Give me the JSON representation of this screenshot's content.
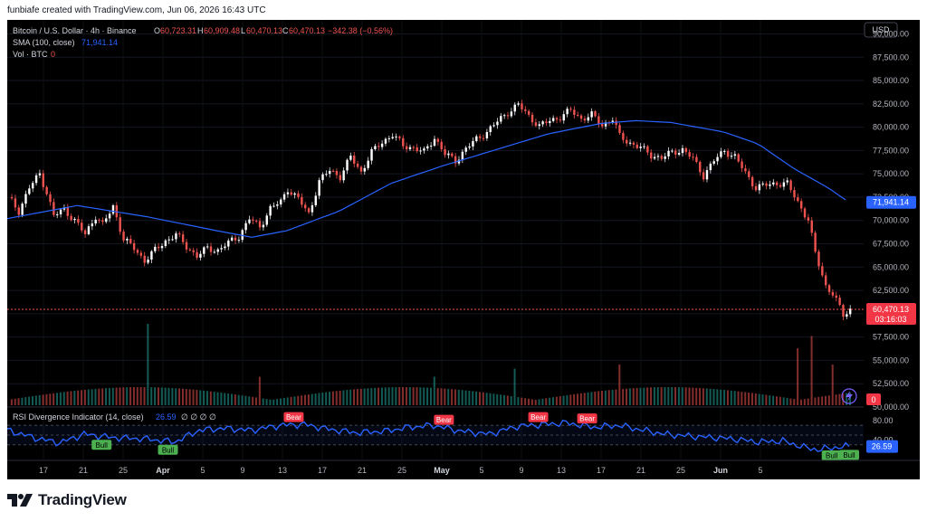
{
  "caption": "funbiafe created with TradingView.com, Jun 06, 2026 16:43 UTC",
  "brand": "TradingView",
  "legend": {
    "symbol": "Bitcoin / U.S. Dollar · 4h · Binance",
    "o_label": "O",
    "o_value": "60,723.31",
    "h_label": "H",
    "h_value": "60,909.48",
    "l_label": "L",
    "l_value": "60,470.13",
    "c_label": "C",
    "c_value": "60,470.13",
    "change": "−342.38 (−0.56%)",
    "sma_label": "SMA (100, close)",
    "sma_value": "71,941.14",
    "vol_label": "Vol · BTC",
    "vol_value": "0"
  },
  "currency": "USD",
  "rsi": {
    "title": "RSI Divergence Indicator (14, close)",
    "value": "26.59",
    "markers": "∅ ∅ ∅ ∅",
    "ticks": [
      "80.00",
      "40.00"
    ],
    "signals": [
      {
        "label": "Bull",
        "kind": "bull",
        "pos": 0.11
      },
      {
        "label": "Bull",
        "kind": "bull",
        "pos": 0.19
      },
      {
        "label": "Bear",
        "kind": "bear",
        "pos": 0.34
      },
      {
        "label": "Bear",
        "kind": "bear",
        "pos": 0.52
      },
      {
        "label": "Bear",
        "kind": "bear",
        "pos": 0.63
      },
      {
        "label": "Bear",
        "kind": "bear",
        "pos": 0.69
      },
      {
        "label": "Bull",
        "kind": "bull",
        "pos": 0.98
      },
      {
        "label": "Bull",
        "kind": "bull",
        "pos": 1.0
      }
    ]
  },
  "price_badges": {
    "sma": "71,941.14",
    "last": "60,470.13",
    "countdown": "03:16:03",
    "vol": "0"
  },
  "colors": {
    "up": "#26a69a",
    "down": "#ef5350",
    "sma": "#2962ff",
    "rsi_line": "#2962ff",
    "bull": "#4caf50",
    "bear": "#f23645",
    "background": "#000000",
    "axis_text": "#b2b5be"
  },
  "chart_data": {
    "type": "candlestick",
    "title": "Bitcoin / U.S. Dollar · 4h · Binance",
    "y_axis_ticks": [
      "90,000.00",
      "87,500.00",
      "85,000.00",
      "82,500.00",
      "80,000.00",
      "77,500.00",
      "75,000.00",
      "72,500.00",
      "70,000.00",
      "67,500.00",
      "65,000.00",
      "62,500.00",
      "60,000.00",
      "57,500.00",
      "55,000.00",
      "52,500.00",
      "50,000.00"
    ],
    "ylim": [
      50000,
      91500
    ],
    "x_axis_ticks": [
      "17",
      "21",
      "25",
      "Apr",
      "5",
      "9",
      "13",
      "17",
      "21",
      "25",
      "May",
      "5",
      "9",
      "13",
      "17",
      "21",
      "25",
      "Jun",
      "5"
    ],
    "close_path": [
      [
        0,
        72500
      ],
      [
        3,
        71000
      ],
      [
        6,
        73500
      ],
      [
        9,
        75000
      ],
      [
        11,
        73000
      ],
      [
        13,
        70500
      ],
      [
        16,
        71200
      ],
      [
        19,
        70000
      ],
      [
        22,
        68500
      ],
      [
        25,
        70500
      ],
      [
        27,
        69500
      ],
      [
        30,
        71500
      ],
      [
        33,
        68000
      ],
      [
        36,
        67000
      ],
      [
        39,
        65700
      ],
      [
        42,
        66800
      ],
      [
        45,
        67800
      ],
      [
        48,
        68500
      ],
      [
        51,
        67200
      ],
      [
        54,
        66200
      ],
      [
        57,
        67000
      ],
      [
        60,
        66800
      ],
      [
        63,
        67600
      ],
      [
        66,
        68300
      ],
      [
        69,
        70200
      ],
      [
        72,
        69300
      ],
      [
        75,
        71300
      ],
      [
        78,
        72000
      ],
      [
        80,
        73400
      ],
      [
        83,
        72300
      ],
      [
        86,
        70700
      ],
      [
        89,
        74200
      ],
      [
        92,
        75400
      ],
      [
        95,
        74700
      ],
      [
        98,
        76800
      ],
      [
        101,
        75200
      ],
      [
        104,
        77300
      ],
      [
        107,
        78400
      ],
      [
        110,
        79200
      ],
      [
        113,
        78000
      ],
      [
        116,
        77800
      ],
      [
        119,
        77300
      ],
      [
        122,
        78900
      ],
      [
        125,
        77100
      ],
      [
        128,
        76400
      ],
      [
        131,
        77700
      ],
      [
        134,
        78700
      ],
      [
        137,
        79500
      ],
      [
        140,
        80600
      ],
      [
        143,
        81600
      ],
      [
        146,
        82400
      ],
      [
        149,
        81200
      ],
      [
        152,
        80100
      ],
      [
        155,
        80700
      ],
      [
        158,
        81100
      ],
      [
        161,
        81800
      ],
      [
        164,
        80900
      ],
      [
        167,
        81300
      ],
      [
        170,
        80200
      ],
      [
        173,
        80900
      ],
      [
        175,
        79000
      ],
      [
        178,
        78300
      ],
      [
        181,
        77800
      ],
      [
        184,
        77000
      ],
      [
        187,
        76700
      ],
      [
        190,
        77300
      ],
      [
        193,
        77600
      ],
      [
        196,
        76600
      ],
      [
        199,
        74800
      ],
      [
        202,
        76400
      ],
      [
        205,
        77500
      ],
      [
        208,
        76800
      ],
      [
        211,
        75100
      ],
      [
        214,
        73500
      ],
      [
        217,
        73800
      ],
      [
        220,
        74000
      ],
      [
        223,
        73900
      ],
      [
        226,
        72000
      ],
      [
        229,
        70000
      ],
      [
        231,
        66500
      ],
      [
        234,
        63000
      ],
      [
        236,
        62100
      ],
      [
        239,
        59900
      ],
      [
        241,
        60470
      ]
    ],
    "sma_100": [
      [
        0,
        70200
      ],
      [
        20,
        71600
      ],
      [
        40,
        70400
      ],
      [
        60,
        68900
      ],
      [
        70,
        68200
      ],
      [
        80,
        68900
      ],
      [
        95,
        71000
      ],
      [
        110,
        74000
      ],
      [
        125,
        75900
      ],
      [
        140,
        77600
      ],
      [
        155,
        79300
      ],
      [
        170,
        80400
      ],
      [
        180,
        80700
      ],
      [
        190,
        80500
      ],
      [
        205,
        79500
      ],
      [
        215,
        78200
      ],
      [
        225,
        75600
      ],
      [
        235,
        73500
      ],
      [
        241,
        71941
      ]
    ],
    "volume_spikes": [
      [
        40,
        1.0
      ],
      [
        72,
        0.35
      ],
      [
        122,
        0.35
      ],
      [
        145,
        0.45
      ],
      [
        175,
        0.5
      ],
      [
        226,
        0.7
      ],
      [
        230,
        0.85
      ],
      [
        236,
        0.5
      ]
    ],
    "rsi_14": [
      [
        0,
        60
      ],
      [
        8,
        44
      ],
      [
        15,
        34
      ],
      [
        22,
        52
      ],
      [
        30,
        45
      ],
      [
        40,
        42
      ],
      [
        48,
        36
      ],
      [
        55,
        60
      ],
      [
        62,
        64
      ],
      [
        70,
        60
      ],
      [
        78,
        70
      ],
      [
        85,
        72
      ],
      [
        92,
        62
      ],
      [
        100,
        55
      ],
      [
        108,
        58
      ],
      [
        115,
        66
      ],
      [
        122,
        70
      ],
      [
        130,
        58
      ],
      [
        138,
        52
      ],
      [
        146,
        68
      ],
      [
        154,
        72
      ],
      [
        160,
        75
      ],
      [
        168,
        66
      ],
      [
        175,
        70
      ],
      [
        182,
        60
      ],
      [
        188,
        52
      ],
      [
        195,
        48
      ],
      [
        202,
        45
      ],
      [
        208,
        42
      ],
      [
        215,
        36
      ],
      [
        222,
        38
      ],
      [
        228,
        25
      ],
      [
        232,
        20
      ],
      [
        236,
        24
      ],
      [
        241,
        27
      ]
    ],
    "rsi_ticks": [
      80,
      40
    ]
  }
}
